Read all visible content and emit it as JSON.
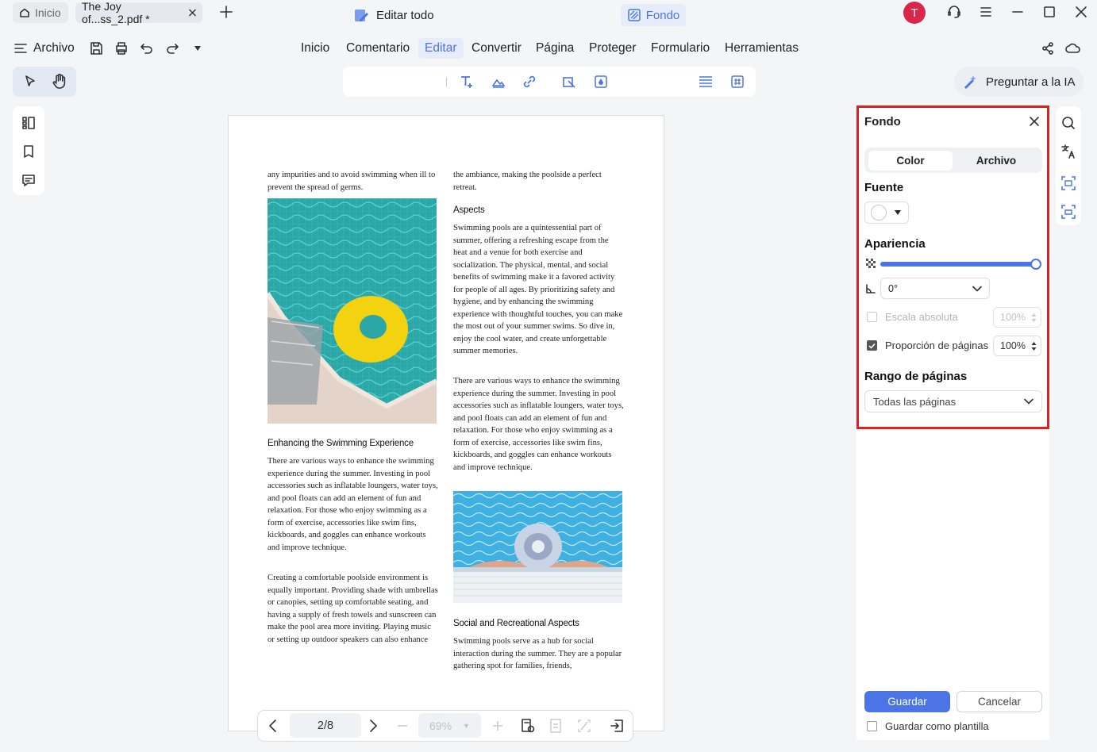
{
  "tabs": {
    "home_label": "Inicio",
    "doc_label": "The Joy of...ss_2.pdf *"
  },
  "user": {
    "avatar_letter": "T",
    "avatar_color": "#d9264a"
  },
  "menu": {
    "file_label": "Archivo",
    "items": [
      "Inicio",
      "Comentario",
      "Editar",
      "Convertir",
      "Página",
      "Proteger",
      "Formulario",
      "Herramientas"
    ],
    "active_index": 2
  },
  "edit_toolbar": {
    "edit_all_label": "Editar todo",
    "background_label": "Fondo"
  },
  "ai_button": {
    "label": "Preguntar a la IA"
  },
  "document": {
    "col1_intro": "any impurities and to avoid swimming when ill to prevent the spread of germs.",
    "col1_heading": "Enhancing the Swimming Experience",
    "col1_para1": "There are various ways to enhance the swimming experience during the summer. Investing in pool accessories such as inflatable loungers, water toys, and pool floats can add an element of fun and relaxation. For those who enjoy swimming as a form of exercise, accessories like swim fins, kickboards, and goggles can enhance workouts and improve technique.",
    "col1_para2": "Creating a comfortable poolside environment is equally important. Providing shade with umbrellas or canopies, setting up comfortable seating, and having a supply of fresh towels and sunscreen can make the pool area more inviting. Playing music or setting up outdoor speakers can also enhance",
    "col2_intro": "the ambiance, making the poolside a perfect retreat.",
    "col2_heading1": "Aspects",
    "col2_para1": "Swimming pools are a quintessential part of summer, offering a refreshing escape from the heat and a venue for both exercise and socialization. The physical, mental, and social benefits of swimming make it a favored activity for people of all ages. By prioritizing safety and hygiene, and by enhancing the swimming experience with thoughtful touches, you can make the most out of your summer swims. So dive in, enjoy the cool water, and create unforgettable summer memories.",
    "col2_para2": "There are various ways to enhance the swimming experience during the summer. Investing in pool accessories such as inflatable loungers, water toys, and pool floats can add an element of fun and relaxation. For those who enjoy swimming as a form of exercise, accessories like swim fins, kickboards, and goggles can enhance workouts and improve technique.",
    "col2_heading2": "Social and Recreational Aspects",
    "col2_para3": "Swimming pools serve as a hub for social interaction during the summer. They are a popular gathering spot for families, friends,"
  },
  "nav": {
    "page_indicator": "2/8",
    "zoom": "69%"
  },
  "panel": {
    "title": "Fondo",
    "tab_color": "Color",
    "tab_file": "Archivo",
    "source_label": "Fuente",
    "source_color": "#ffffff",
    "appearance_label": "Apariencia",
    "opacity_fraction": 1.0,
    "accent": "#4b74e6",
    "rotation_value": "0°",
    "absolute_scale_label": "Escala absoluta",
    "absolute_scale_value": "100%",
    "absolute_scale_checked": false,
    "page_ratio_label": "Proporción de páginas",
    "page_ratio_value": "100%",
    "page_ratio_checked": true,
    "range_label": "Rango de páginas",
    "range_value": "Todas las páginas",
    "save_label": "Guardar",
    "cancel_label": "Cancelar",
    "template_label": "Guardar como plantilla"
  }
}
